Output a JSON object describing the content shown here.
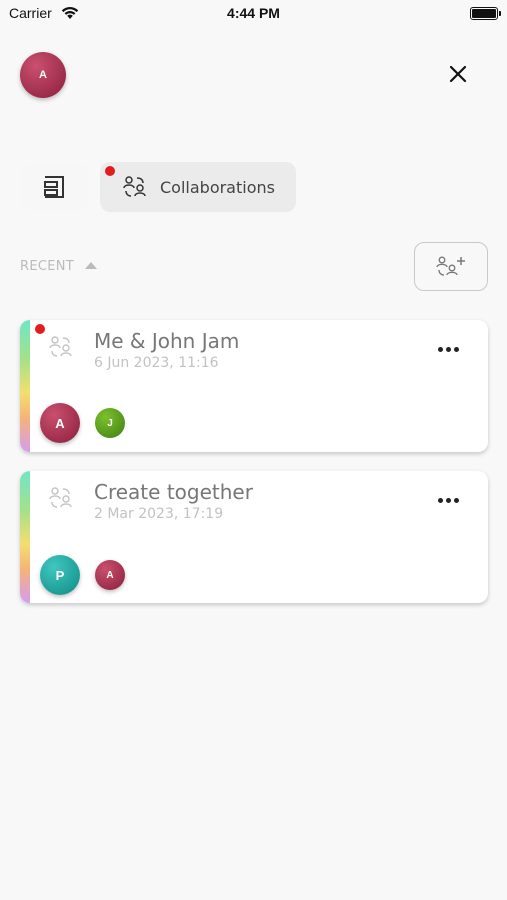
{
  "status_bar": {
    "carrier": "Carrier",
    "time": "4:44 PM"
  },
  "profile": {
    "initial": "A"
  },
  "tabs": {
    "collaborations_label": "Collaborations"
  },
  "section": {
    "recent_label": "RECENT"
  },
  "collaborations": [
    {
      "title": "Me & John Jam",
      "date": "6 Jun 2023, 11:16",
      "unread": true,
      "owner_initial": "A",
      "member_initials": [
        "J"
      ]
    },
    {
      "title": "Create together",
      "date": "2 Mar 2023, 17:19",
      "unread": false,
      "owner_initial": "P",
      "member_initials": [
        "A"
      ]
    }
  ],
  "icons": {
    "close": "close-icon",
    "layout": "layout-icon",
    "collaborations": "collaboration-icon",
    "add_collaboration": "add-collaborator-icon",
    "sort": "sort-ascending-icon",
    "more": "more-horizontal-icon"
  },
  "colors": {
    "notification": "#e11d1d",
    "avatar_a": "#a8304f",
    "avatar_j": "#5a9e1c",
    "avatar_p": "#1fa9a1"
  }
}
